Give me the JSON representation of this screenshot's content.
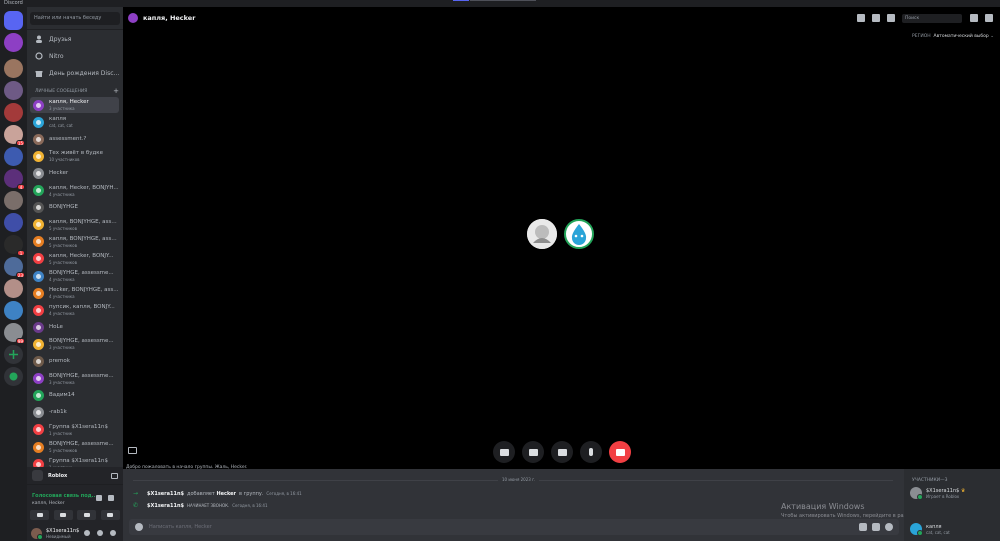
{
  "window": {
    "title": "Discord"
  },
  "servers": [
    {
      "name": "home",
      "color": "#5865f2",
      "badge": ""
    },
    {
      "name": "group",
      "color": "#8d3fc4",
      "badge": ""
    },
    {
      "name": "server-1",
      "color": "#9a7560",
      "badge": ""
    },
    {
      "name": "server-2",
      "color": "#6e5a85",
      "badge": ""
    },
    {
      "name": "server-3",
      "color": "#a33a3a",
      "badge": ""
    },
    {
      "name": "server-4",
      "color": "#c9a39a",
      "badge": "15"
    },
    {
      "name": "server-5",
      "color": "#3d5bb0",
      "badge": ""
    },
    {
      "name": "server-6",
      "color": "#5c2f7a",
      "badge": "4"
    },
    {
      "name": "server-7",
      "color": "#7a6e6a",
      "badge": ""
    },
    {
      "name": "folder",
      "color": "#3f4ea8",
      "badge": ""
    },
    {
      "name": "server-8",
      "color": "#2a2a2a",
      "badge": "1"
    },
    {
      "name": "server-9",
      "color": "#4e6b9a",
      "badge": "23"
    },
    {
      "name": "server-10",
      "color": "#b38f88",
      "badge": ""
    },
    {
      "name": "server-11",
      "color": "#3e82c4",
      "badge": ""
    },
    {
      "name": "server-12",
      "color": "#8a8d92",
      "badge": "99"
    }
  ],
  "search": {
    "placeholder": "Найти или начать беседу"
  },
  "nav": {
    "friends": "Друзья",
    "nitro": "Nitro",
    "birthday": "День рождения Disc..."
  },
  "dm_header": "ЛИЧНЫЕ СООБЩЕНИЯ",
  "dms": [
    {
      "name": "капля, Hecker",
      "sub": "3 участника",
      "color": "#8d3fc4",
      "selected": true
    },
    {
      "name": "капля",
      "sub": "cat, cat, cat",
      "color": "#2aa4d8"
    },
    {
      "name": "assessment.?",
      "sub": "",
      "color": "#8a6a5a"
    },
    {
      "name": "Тех живёт в будке",
      "sub": "10 участников",
      "color": "#f0b232"
    },
    {
      "name": "Hecker",
      "sub": "",
      "color": "#8a8d92"
    },
    {
      "name": "капля, Hecker, BONJYH...",
      "sub": "4 участника",
      "color": "#23a55a"
    },
    {
      "name": "BONJYHGE",
      "sub": "",
      "color": "#555"
    },
    {
      "name": "капля, BONJYHGE, asse...",
      "sub": "5 участников",
      "color": "#f0b232"
    },
    {
      "name": "капля, BONJYHGE, asse...",
      "sub": "5 участников",
      "color": "#e67e22"
    },
    {
      "name": "капля, Hecker, BONJY...",
      "sub": "5 участников",
      "color": "#f23f43"
    },
    {
      "name": "BONJYHGE, assessme...",
      "sub": "4 участника",
      "color": "#3e82c4"
    },
    {
      "name": "Hecker, BONJYHGE, ass...",
      "sub": "4 участника",
      "color": "#e67e22"
    },
    {
      "name": "пупсик, капля, BONJY...",
      "sub": "4 участника",
      "color": "#f23f43"
    },
    {
      "name": "HoLe",
      "sub": "",
      "color": "#6a3a8a"
    },
    {
      "name": "BONJYHGE, assessme...",
      "sub": "3 участника",
      "color": "#f0b232"
    },
    {
      "name": "premok",
      "sub": "",
      "color": "#6e5a4a"
    },
    {
      "name": "BONJYHGE, assessme...",
      "sub": "3 участника",
      "color": "#8d3fc4"
    },
    {
      "name": "Вадим14",
      "sub": "",
      "color": "#23a55a"
    },
    {
      "name": "-rab1k",
      "sub": "",
      "color": "#8a8d92"
    },
    {
      "name": "Группа $X1sera11n$",
      "sub": "1 участник",
      "color": "#f23f43"
    },
    {
      "name": "BONJYHGE, assessme...",
      "sub": "5 участников",
      "color": "#e67e22"
    },
    {
      "name": "Группа $X1sera11n$",
      "sub": "1 участник",
      "color": "#f23f43"
    }
  ],
  "voice_panel": {
    "game": "Roblox",
    "status": "Голосовая связь под...",
    "channel": "капля, Hecker"
  },
  "user": {
    "name": "$X1sera11n$",
    "tag": "Невидимый"
  },
  "header": {
    "title": "капля, Hecker",
    "search_placeholder": "Поиск"
  },
  "region": {
    "label": "РЕГИОН",
    "value": "Автоматический выбор"
  },
  "chat": {
    "cut_text": "Добро пожаловать в начало группы. Жаль, Hecker.",
    "date": "10 июня 2023 г.",
    "messages": [
      {
        "user": "$X1sera11n$",
        "action": "добавляет",
        "target": "Hecker",
        "rest": "в группу.",
        "time": "Сегодня, в 16:41"
      },
      {
        "user": "$X1sera11n$",
        "action": "НАЧИНАЕТ ЗВОНОК.",
        "target": "",
        "rest": "",
        "time": "Сегодня, в 16:41"
      }
    ],
    "input_placeholder": "Написать капля, Hecker"
  },
  "watermark": {
    "line1": "Активация Windows",
    "line2": "Чтобы активировать Windows, перейдите в раздел \"Параметры\"."
  },
  "members": {
    "header": "УЧАСТНИКИ—3",
    "list": [
      {
        "name": "$X1sera11n$",
        "status": "Играет в Roblox",
        "color": "#8a8d92"
      },
      {
        "name": "капля",
        "status": "cat, cat, cat",
        "color": "#2aa4d8"
      }
    ]
  },
  "colors": {
    "accent": "#5865f2",
    "green": "#23a55a",
    "red": "#f23f43"
  }
}
